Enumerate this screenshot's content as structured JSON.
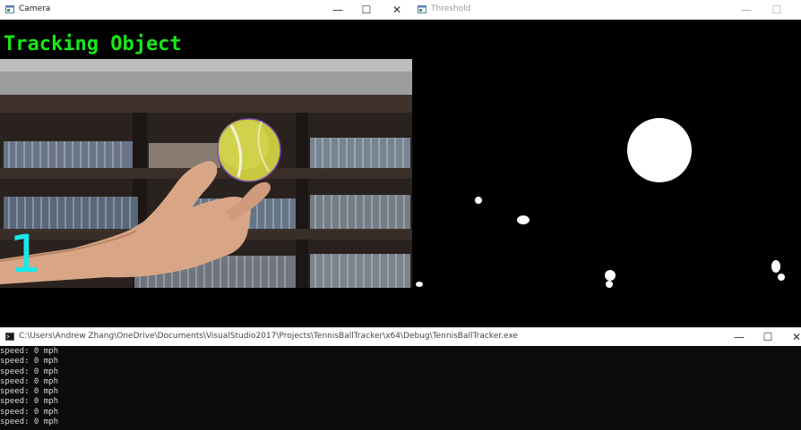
{
  "camera_window": {
    "title": "Camera",
    "overlay_text": "Tracking Object",
    "counter": "1",
    "overlay_color": "#17e817",
    "counter_color": "#17e8e8"
  },
  "threshold_window": {
    "title": "Threshold"
  },
  "console_window": {
    "title": "C:\\Users\\Andrew Zhang\\OneDrive\\Documents\\VisualStudio2017\\Projects\\TennisBallTracker\\x64\\Debug\\TennisBallTracker.exe",
    "lines": [
      "speed: 0 mph",
      "speed: 0 mph",
      "speed: 0 mph",
      "speed: 0 mph",
      "speed: 0 mph",
      "speed: 0 mph",
      "speed: 0 mph",
      "speed: 0 mph"
    ]
  },
  "window_controls": {
    "minimize": "—",
    "maximize": "☐",
    "close": "✕"
  }
}
